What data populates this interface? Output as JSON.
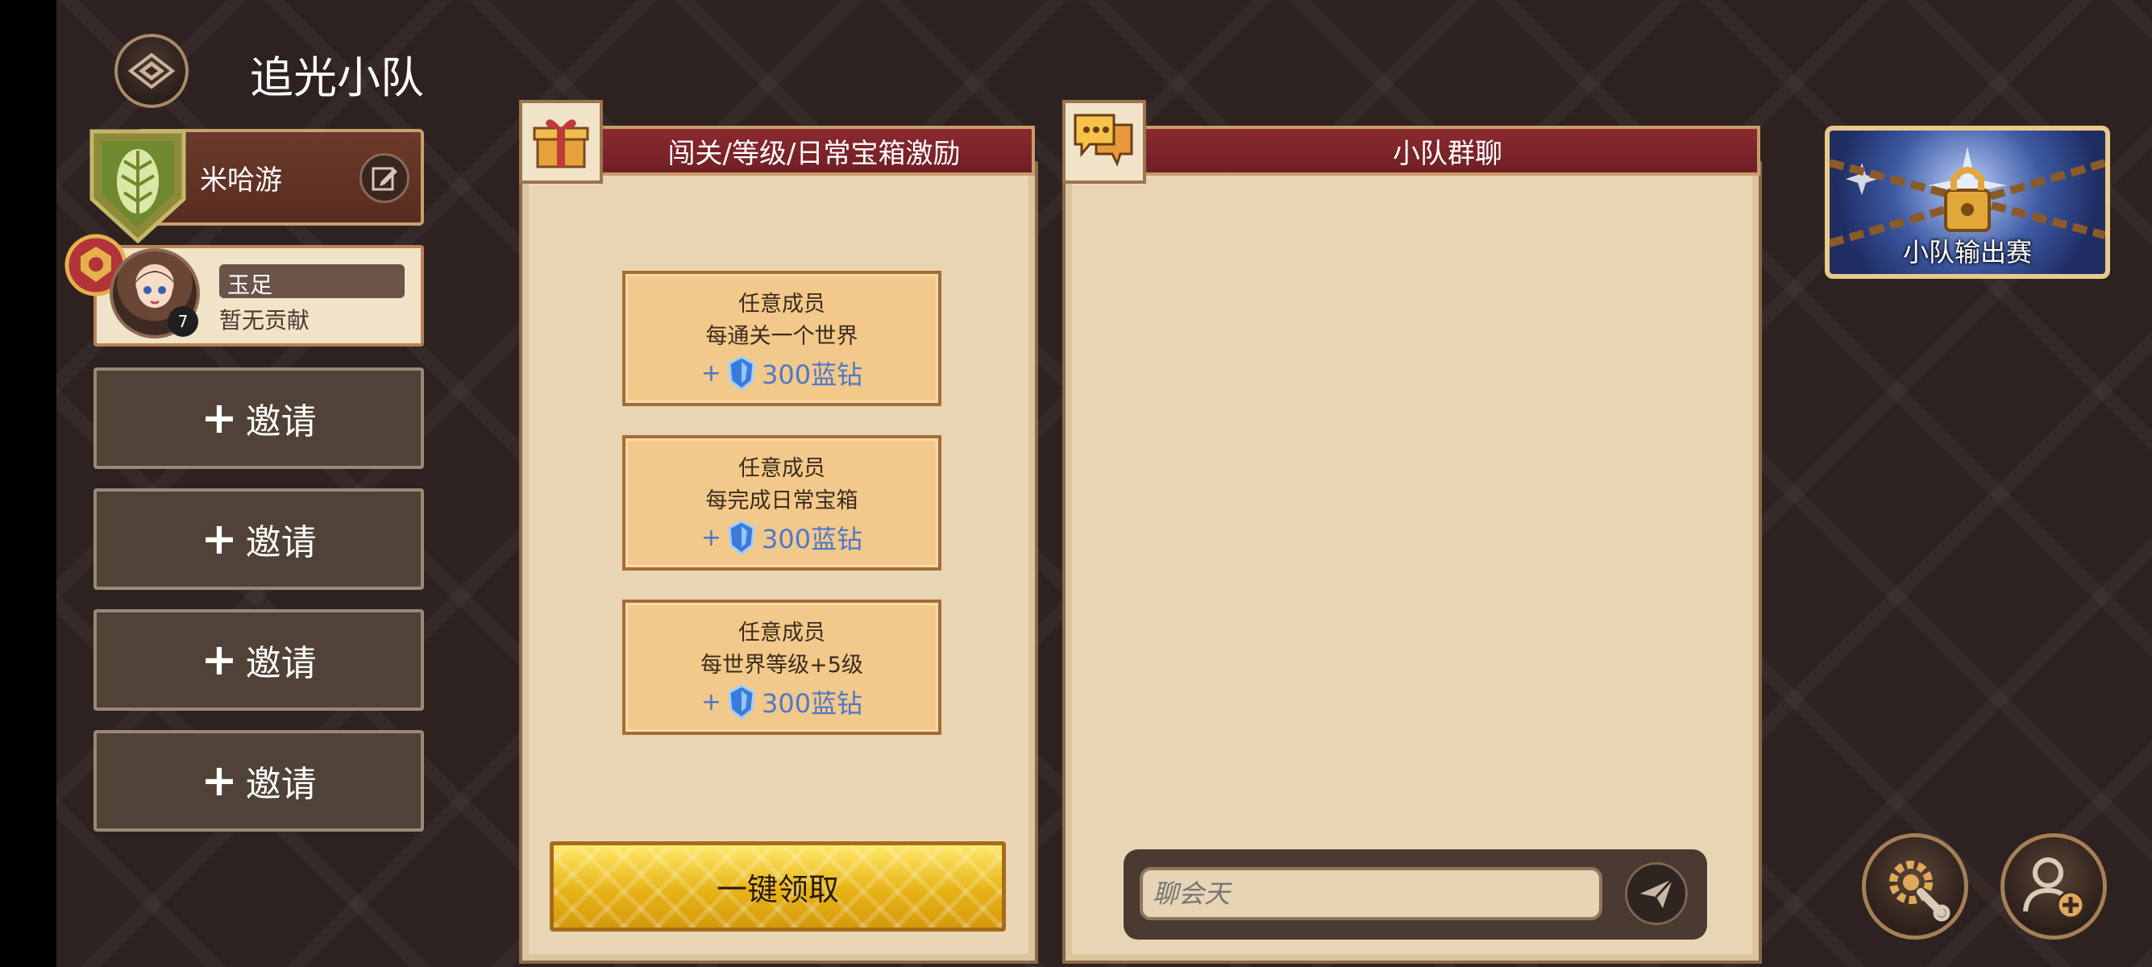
{
  "header": {
    "title": "追光小队"
  },
  "team": {
    "name": "米哈游"
  },
  "member": {
    "name": "玉足",
    "contribution": "暂无贡献",
    "level": "7"
  },
  "invites": [
    {
      "plus": "+",
      "label": "邀请"
    },
    {
      "plus": "+",
      "label": "邀请"
    },
    {
      "plus": "+",
      "label": "邀请"
    },
    {
      "plus": "+",
      "label": "邀请"
    }
  ],
  "rewards_panel": {
    "title": "闯关/等级/日常宝箱激励",
    "items": [
      {
        "who": "任意成员",
        "condition": "每通关一个世界",
        "plus": "+",
        "amount": "300蓝钻"
      },
      {
        "who": "任意成员",
        "condition": "每完成日常宝箱",
        "plus": "+",
        "amount": "300蓝钻"
      },
      {
        "who": "任意成员",
        "condition": "每世界等级+5级",
        "plus": "+",
        "amount": "300蓝钻"
      }
    ],
    "claim_label": "一键领取"
  },
  "chat_panel": {
    "title": "小队群聊",
    "input_placeholder": "聊会天"
  },
  "boss": {
    "label": "小队输出赛"
  },
  "icons": {
    "back": "back-arrow-icon",
    "edit": "edit-icon",
    "gift": "gift-icon",
    "chat": "chat-bubbles-icon",
    "send": "paper-plane-icon",
    "settings": "gear-wrench-icon",
    "add_member": "add-user-icon",
    "lock": "lock-icon"
  },
  "colors": {
    "accent_red": "#8b2a2f",
    "gold": "#e7b417",
    "diamond_blue": "#4e78c9"
  }
}
